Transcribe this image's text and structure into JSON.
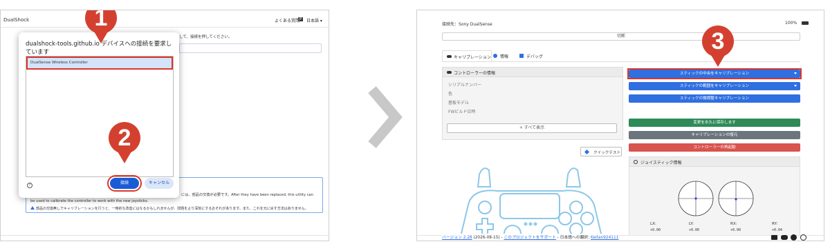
{
  "left": {
    "app_title": "DualShock",
    "faq_link": "よくある質問",
    "lang_badge": "JP",
    "lang_select": "日本語",
    "instruction_text": "して、接続を押してください。",
    "popup": {
      "origin": "dualshock-tools.github.io",
      "request_text": "デバイスへの接続を要求し",
      "request_text2": "ています",
      "device_name": "DualSense Wireless Controller",
      "help_icon": "?",
      "connect_label": "接続",
      "cancel_label": "キャンセル"
    },
    "info_box": {
      "line1": "には、部品の交換が必要です。After they have been replaced, this utility can",
      "line2": "be used to calibrate the controller to work with the new joysticks.",
      "line3": "部品の交換無しでキャリブレーションを行うと、一時的な改善にはなるかもしれませんが、問題をより深刻にするおそれがあります。また、これを元に戻す方法はありません。"
    }
  },
  "footer": {
    "version_link": "バージョン 2.28",
    "version_date": "(2026-08-15)",
    "sep": " - ",
    "support_link": "このプロジェクトをサポート",
    "translation_text": " - 日本語への翻訳: ",
    "translator_link": "Keitan924111"
  },
  "right": {
    "connected_label": "接続先：",
    "device_name": "Sony DualSense",
    "battery": "100%",
    "disconnect_label": "切断",
    "tabs": [
      "キャリブレーション",
      "情報",
      "デバッグ"
    ],
    "info_card": {
      "title": "コントローラーの情報",
      "rows": [
        "シリアルナンバー",
        "色",
        "基板モデル",
        "FWビルド日時"
      ],
      "show_all": "+ すべて表示"
    },
    "quick_test": "クイックテスト",
    "buttons": {
      "center_cal": "スティックの中央をキャリブレーション",
      "range_cal": "スティックの範囲をキャリブレーション",
      "fine_cal": "スティックの微調整キャリブレーション",
      "save_permanent": "変更を永久に保存します",
      "restore_cal": "キャリブレーションの復元",
      "reboot": "コントローラーの再起動"
    },
    "joystick": {
      "title": "ジョイスティック情報",
      "labels": [
        "LX:",
        "LY:",
        "RX:",
        "RY:"
      ],
      "values": [
        "+0.00",
        "+0.00",
        "+0.00",
        "+0.04"
      ]
    }
  },
  "markers": [
    "1",
    "2",
    "3"
  ],
  "colors": {
    "primary": "#2f6fe0",
    "success": "#2e8b57",
    "secondary": "#6c757d",
    "danger": "#d9534f",
    "marker": "#d4402f",
    "highlight": "#d8362b"
  }
}
